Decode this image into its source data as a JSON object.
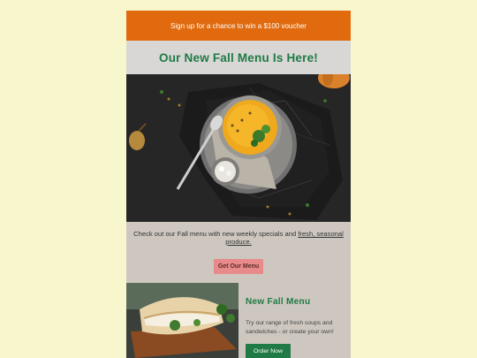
{
  "banner": {
    "text": "Sign up for a chance to win a $100 voucher"
  },
  "header": {
    "title": "Our New Fall Menu Is Here!"
  },
  "intro": {
    "text_before": "Check out our Fall menu with new weekly specials and ",
    "link_text": "fresh, seasonal produce."
  },
  "cta": {
    "label": "Get Our Menu"
  },
  "feature": {
    "title": "New Fall Menu",
    "description": "Try our range of fresh soups and sandwiches - or create your own!",
    "button_label": "Order Now"
  },
  "colors": {
    "page_background": "#f8f6cc",
    "banner": "#e06a0d",
    "accent_green": "#1f7a45",
    "cta_pink": "#e98a8a"
  }
}
